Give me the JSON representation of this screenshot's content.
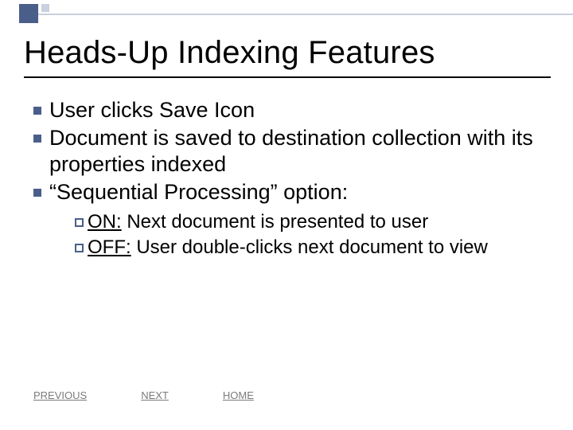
{
  "title": "Heads-Up Indexing Features",
  "bullets": [
    {
      "text": "User clicks Save Icon"
    },
    {
      "text": "Document is saved to destination collection with its properties indexed"
    },
    {
      "text": "“Sequential Processing” option:"
    }
  ],
  "subitems": [
    {
      "label": "ON:",
      "desc": " Next document is presented to user"
    },
    {
      "label": "OFF:",
      "desc": " User double-clicks next document to view"
    }
  ],
  "nav": {
    "previous": "PREVIOUS",
    "next": "NEXT",
    "home": "HOME"
  }
}
